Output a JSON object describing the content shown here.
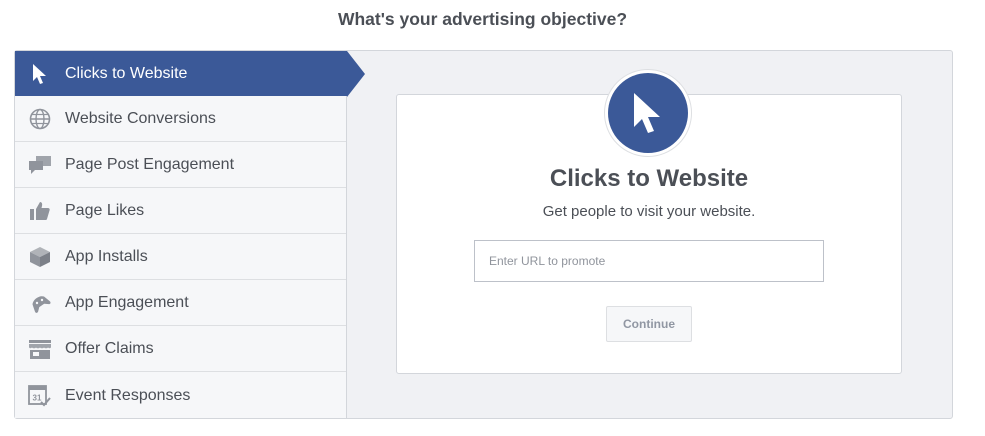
{
  "page": {
    "heading": "What's your advertising objective?"
  },
  "sidebar": {
    "items": [
      {
        "label": "Clicks to Website",
        "icon": "cursor-icon",
        "active": true
      },
      {
        "label": "Website Conversions",
        "icon": "globe-icon"
      },
      {
        "label": "Page Post Engagement",
        "icon": "speech-bubbles-icon"
      },
      {
        "label": "Page Likes",
        "icon": "thumbs-up-icon"
      },
      {
        "label": "App Installs",
        "icon": "box-icon"
      },
      {
        "label": "App Engagement",
        "icon": "gamepad-icon"
      },
      {
        "label": "Offer Claims",
        "icon": "storefront-icon"
      },
      {
        "label": "Event Responses",
        "icon": "calendar-icon"
      }
    ]
  },
  "objective_card": {
    "icon": "cursor-icon",
    "title": "Clicks to Website",
    "subtitle": "Get people to visit your website.",
    "url_input": {
      "value": "",
      "placeholder": "Enter URL to promote"
    },
    "continue_label": "Continue"
  },
  "colors": {
    "accent": "#3b5998",
    "text": "#4b4f56",
    "icon_gray": "#90949c",
    "panel_bg": "#f0f1f4"
  },
  "calendar_icon_day": "31"
}
